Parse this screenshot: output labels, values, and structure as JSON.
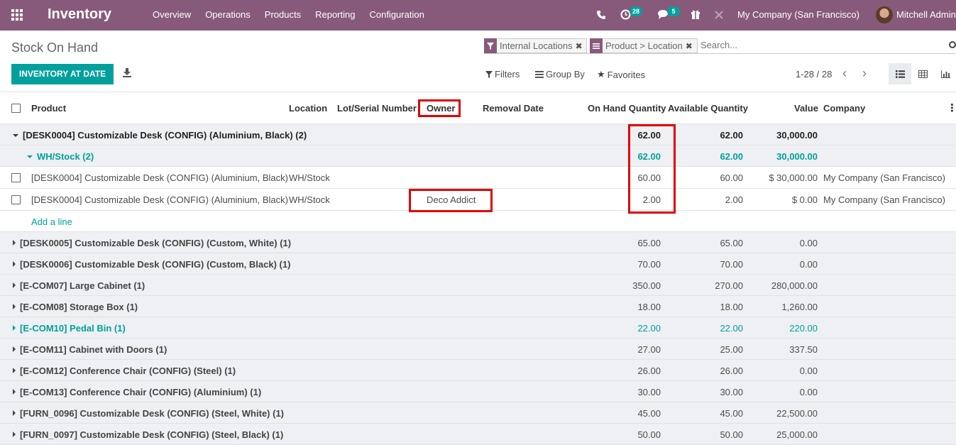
{
  "nav": {
    "brand": "Inventory",
    "menu": [
      "Overview",
      "Operations",
      "Products",
      "Reporting",
      "Configuration"
    ],
    "activity_count": "28",
    "messages_count": "5",
    "company": "My Company (San Francisco)",
    "user": "Mitchell Admin"
  },
  "control": {
    "breadcrumb": "Stock On Hand",
    "facets": [
      "Internal Locations",
      "Product > Location"
    ],
    "search_placeholder": "Search...",
    "inventory_at_date": "INVENTORY AT DATE",
    "filters": "Filters",
    "group_by": "Group By",
    "favorites": "Favorites",
    "pager": "1-28 / 28"
  },
  "columns": {
    "product": "Product",
    "location": "Location",
    "lot": "Lot/Serial Number",
    "owner": "Owner",
    "removal": "Removal Date",
    "on_hand": "On Hand Quantity",
    "available": "Available Quantity",
    "value": "Value",
    "company": "Company"
  },
  "expanded_group": {
    "label": "[DESK0004] Customizable Desk (CONFIG) (Aluminium, Black) (2)",
    "on_hand": "62.00",
    "available": "62.00",
    "value": "30,000.00",
    "subgroup": {
      "label": "WH/Stock (2)",
      "on_hand": "62.00",
      "available": "62.00",
      "value": "30,000.00"
    },
    "records": [
      {
        "product": "[DESK0004] Customizable Desk (CONFIG) (Aluminium, Black)",
        "location": "WH/Stock",
        "owner": "",
        "on_hand": "60.00",
        "available": "60.00",
        "value": "$ 30,000.00",
        "company": "My Company (San Francisco)"
      },
      {
        "product": "[DESK0004] Customizable Desk (CONFIG) (Aluminium, Black)",
        "location": "WH/Stock",
        "owner": "Deco Addict",
        "on_hand": "2.00",
        "available": "2.00",
        "value": "$ 0.00",
        "company": "My Company (San Francisco)"
      }
    ],
    "add_line": "Add a line"
  },
  "groups": [
    {
      "label": "[DESK0005] Customizable Desk (CONFIG) (Custom, White) (1)",
      "on_hand": "65.00",
      "available": "65.00",
      "value": "0.00",
      "teal": false
    },
    {
      "label": "[DESK0006] Customizable Desk (CONFIG) (Custom, Black) (1)",
      "on_hand": "70.00",
      "available": "70.00",
      "value": "0.00",
      "teal": false
    },
    {
      "label": "[E-COM07] Large Cabinet (1)",
      "on_hand": "350.00",
      "available": "270.00",
      "value": "280,000.00",
      "teal": false
    },
    {
      "label": "[E-COM08] Storage Box (1)",
      "on_hand": "18.00",
      "available": "18.00",
      "value": "1,260.00",
      "teal": false
    },
    {
      "label": "[E-COM10] Pedal Bin (1)",
      "on_hand": "22.00",
      "available": "22.00",
      "value": "220.00",
      "teal": true
    },
    {
      "label": "[E-COM11] Cabinet with Doors (1)",
      "on_hand": "27.00",
      "available": "25.00",
      "value": "337.50",
      "teal": false
    },
    {
      "label": "[E-COM12] Conference Chair (CONFIG) (Steel) (1)",
      "on_hand": "26.00",
      "available": "26.00",
      "value": "0.00",
      "teal": false
    },
    {
      "label": "[E-COM13] Conference Chair (CONFIG) (Aluminium) (1)",
      "on_hand": "30.00",
      "available": "30.00",
      "value": "0.00",
      "teal": false
    },
    {
      "label": "[FURN_0096] Customizable Desk (CONFIG) (Steel, White) (1)",
      "on_hand": "45.00",
      "available": "45.00",
      "value": "22,500.00",
      "teal": false
    },
    {
      "label": "[FURN_0097] Customizable Desk (CONFIG) (Steel, Black) (1)",
      "on_hand": "50.00",
      "available": "50.00",
      "value": "25,000.00",
      "teal": false
    }
  ],
  "colors": {
    "brand": "#875a7b",
    "accent": "#00a09d",
    "highlight": "#e00000"
  }
}
